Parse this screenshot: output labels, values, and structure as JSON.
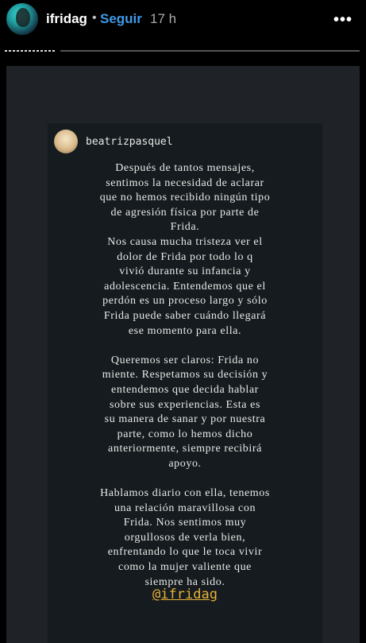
{
  "header": {
    "username": "ifridag",
    "separator": "•",
    "follow_label": "Seguir",
    "time": "17 h",
    "more_icon": "•••"
  },
  "story": {
    "shared_user": "beatrizpasquel",
    "body": "Después de tantos mensajes,\nsentimos la necesidad de aclarar\nque no hemos recibido ningún tipo\nde agresión física por parte de\nFrida.\nNos causa mucha tristeza ver el\ndolor de Frida por todo lo q\nvivió durante su infancia y\nadolescencia. Entendemos que el\nperdón es un proceso largo y sólo\nFrida puede saber cuándo llegará\nese momento para ella.\n\nQueremos ser claros: Frida no\nmiente. Respetamos su decisión y\nentendemos que decida hablar\nsobre sus experiencias. Esta es\nsu manera de sanar y por nuestra\nparte, como lo hemos dicho\nanteriormente, siempre recibirá\napoyo.\n\nHablamos diario con ella, tenemos\nuna relación maravillosa con\nFrida.  Nos sentimos muy\norgullosos de verla bien,\nenfrentando lo que le toca vivir\ncomo la mujer valiente que\nsiempre ha sido.",
    "mention": "@ifridag"
  },
  "colors": {
    "accent": "#3d9ae8",
    "mention": "#e7b23a"
  }
}
